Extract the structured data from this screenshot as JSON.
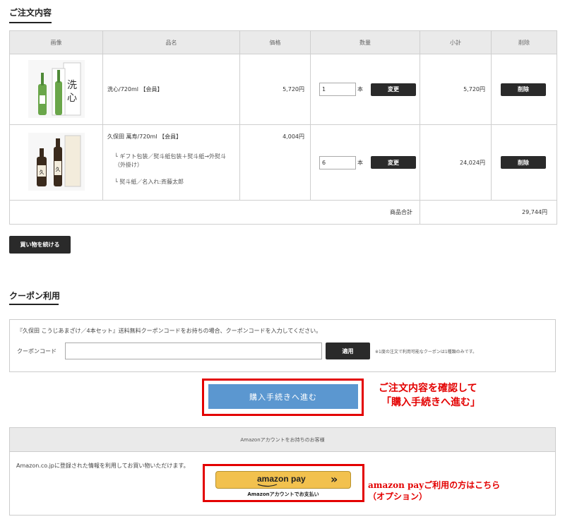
{
  "order": {
    "title": "ご注文内容",
    "headers": {
      "image": "画像",
      "name": "品名",
      "price": "価格",
      "qty": "数量",
      "subtotal": "小計",
      "delete": "削除"
    },
    "rows": [
      {
        "name": "洗心/720ml 【会員】",
        "price": "5,720円",
        "qty": "1",
        "unit": "本",
        "change": "変更",
        "subtotal": "5,720円",
        "delete": "削除",
        "options": []
      },
      {
        "name": "久保田 萬寿/720ml 【会員】",
        "price": "4,004円",
        "qty": "6",
        "unit": "本",
        "change": "変更",
        "subtotal": "24,024円",
        "delete": "削除",
        "options": [
          "└ ギフト包装／熨斗紙包装＋熨斗紙→外熨斗（外掛け）",
          "└ 熨斗紙／名入れ:斉藤太郎"
        ]
      }
    ],
    "total_label": "商品合計",
    "total_value": "29,744円"
  },
  "continue_button": "買い物を続ける",
  "coupon": {
    "title": "クーポン利用",
    "notice": "『久保田 こうじあまざけ／4本セット』送料無料クーポンコードをお持ちの場合、クーポンコードを入力してください。",
    "label": "クーポンコード",
    "input_value": "",
    "apply": "適用",
    "note": "※1度の注文で利用可能なクーポンは1種類のみです。"
  },
  "checkout_button": "購入手続きへ進む",
  "annotation_checkout": [
    "ご注文内容を確認して",
    "「購入手続きへ進む」"
  ],
  "amazon": {
    "header": "Amazonアカウントをお持ちのお客様",
    "desc": "Amazon.co.jpに登録された情報を利用してお買い物いただけます。",
    "button_logo": "amazon pay",
    "button_arrows": "»",
    "caption": "Amazonアカウントでお支払い"
  },
  "annotation_amazon": [
    "amazon payご利用の方はこちら",
    "（オプション）"
  ],
  "colors": {
    "red": "#e30000",
    "checkout_blue": "#5b97d0",
    "amazon_gold": "#f2c14e"
  }
}
